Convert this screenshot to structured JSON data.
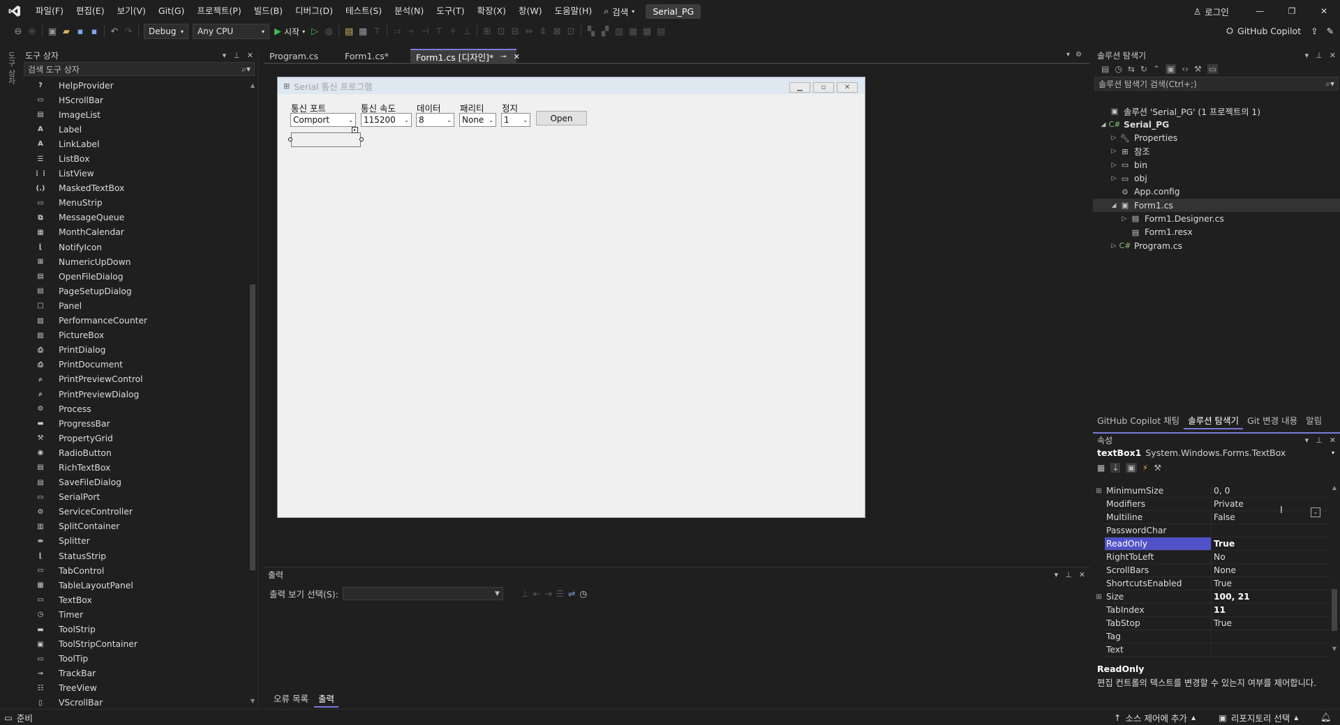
{
  "menu": {
    "items": [
      "파일(F)",
      "편집(E)",
      "보기(V)",
      "Git(G)",
      "프로젝트(P)",
      "빌드(B)",
      "디버그(D)",
      "테스트(S)",
      "분석(N)",
      "도구(T)",
      "확장(X)",
      "창(W)",
      "도움말(H)"
    ],
    "search_label": "검색",
    "solution_badge": "Serial_PG",
    "login_label": "로그인"
  },
  "toolbar": {
    "config": "Debug",
    "platform": "Any CPU",
    "start_label": "시작",
    "copilot_label": "GitHub Copilot"
  },
  "left_strip": {
    "label": "도구 상자"
  },
  "toolbox": {
    "title": "도구 상자",
    "search_placeholder": "검색 도구 상자",
    "items": [
      {
        "label": "HelpProvider",
        "icon": "help-icon"
      },
      {
        "label": "HScrollBar",
        "icon": "hscrollbar-icon"
      },
      {
        "label": "ImageList",
        "icon": "imagelist-icon"
      },
      {
        "label": "Label",
        "icon": "label-icon"
      },
      {
        "label": "LinkLabel",
        "icon": "linklabel-icon"
      },
      {
        "label": "ListBox",
        "icon": "listbox-icon"
      },
      {
        "label": "ListView",
        "icon": "listview-icon"
      },
      {
        "label": "MaskedTextBox",
        "icon": "maskedtextbox-icon"
      },
      {
        "label": "MenuStrip",
        "icon": "menustrip-icon"
      },
      {
        "label": "MessageQueue",
        "icon": "messagequeue-icon"
      },
      {
        "label": "MonthCalendar",
        "icon": "monthcalendar-icon"
      },
      {
        "label": "NotifyIcon",
        "icon": "notifyicon-icon"
      },
      {
        "label": "NumericUpDown",
        "icon": "numericupdown-icon"
      },
      {
        "label": "OpenFileDialog",
        "icon": "openfiledialog-icon"
      },
      {
        "label": "PageSetupDialog",
        "icon": "pagesetupdialog-icon"
      },
      {
        "label": "Panel",
        "icon": "panel-icon"
      },
      {
        "label": "PerformanceCounter",
        "icon": "performancecounter-icon"
      },
      {
        "label": "PictureBox",
        "icon": "picturebox-icon"
      },
      {
        "label": "PrintDialog",
        "icon": "printdialog-icon"
      },
      {
        "label": "PrintDocument",
        "icon": "printdocument-icon"
      },
      {
        "label": "PrintPreviewControl",
        "icon": "printpreviewcontrol-icon"
      },
      {
        "label": "PrintPreviewDialog",
        "icon": "printpreviewdialog-icon"
      },
      {
        "label": "Process",
        "icon": "process-icon"
      },
      {
        "label": "ProgressBar",
        "icon": "progressbar-icon"
      },
      {
        "label": "PropertyGrid",
        "icon": "propertygrid-icon"
      },
      {
        "label": "RadioButton",
        "icon": "radiobutton-icon"
      },
      {
        "label": "RichTextBox",
        "icon": "richtextbox-icon"
      },
      {
        "label": "SaveFileDialog",
        "icon": "savefiledialog-icon"
      },
      {
        "label": "SerialPort",
        "icon": "serialport-icon"
      },
      {
        "label": "ServiceController",
        "icon": "servicecontroller-icon"
      },
      {
        "label": "SplitContainer",
        "icon": "splitcontainer-icon"
      },
      {
        "label": "Splitter",
        "icon": "splitter-icon"
      },
      {
        "label": "StatusStrip",
        "icon": "statusstrip-icon"
      },
      {
        "label": "TabControl",
        "icon": "tabcontrol-icon"
      },
      {
        "label": "TableLayoutPanel",
        "icon": "tablelayoutpanel-icon"
      },
      {
        "label": "TextBox",
        "icon": "textbox-icon"
      },
      {
        "label": "Timer",
        "icon": "timer-icon"
      },
      {
        "label": "ToolStrip",
        "icon": "toolstrip-icon"
      },
      {
        "label": "ToolStripContainer",
        "icon": "toolstripcontainer-icon"
      },
      {
        "label": "ToolTip",
        "icon": "tooltip-icon"
      },
      {
        "label": "TrackBar",
        "icon": "trackbar-icon"
      },
      {
        "label": "TreeView",
        "icon": "treeview-icon"
      },
      {
        "label": "VScrollBar",
        "icon": "vscrollbar-icon"
      }
    ]
  },
  "doc_tabs": [
    {
      "label": "Program.cs",
      "active": false
    },
    {
      "label": "Form1.cs*",
      "active": false
    },
    {
      "label": "Form1.cs [디자인]*",
      "active": true
    }
  ],
  "form": {
    "title": "Serial 통신 프로그램",
    "labels": {
      "port": "통신 포트",
      "speed": "통신 속도",
      "data": "데이터",
      "parity": "패리티",
      "stop": "정지"
    },
    "combos": {
      "port": "Comport",
      "speed": "115200",
      "data": "8",
      "parity": "None",
      "stop": "1"
    },
    "open_button": "Open"
  },
  "output": {
    "title": "출력",
    "select_label": "출력 보기 선택(S):",
    "bottom_tabs": [
      {
        "label": "오류 목록",
        "active": false
      },
      {
        "label": "출력",
        "active": true
      }
    ]
  },
  "solution": {
    "title": "솔루션 탐색기",
    "search_placeholder": "솔루션 탐색기 검색(Ctrl+;)",
    "tree": [
      {
        "label": "솔루션 'Serial_PG' (1 프로젝트의 1)",
        "level": 0,
        "arrow": "",
        "icon": "solution-icon",
        "sel": false,
        "bold": false
      },
      {
        "label": "Serial_PG",
        "level": 0,
        "arrow": "◢",
        "icon": "csproj-icon",
        "sel": false,
        "bold": true
      },
      {
        "label": "Properties",
        "level": 1,
        "arrow": "▷",
        "icon": "wrench-icon",
        "sel": false,
        "bold": false
      },
      {
        "label": "참조",
        "level": 1,
        "arrow": "▷",
        "icon": "references-icon",
        "sel": false,
        "bold": false
      },
      {
        "label": "bin",
        "level": 1,
        "arrow": "▷",
        "icon": "folder-icon",
        "sel": false,
        "bold": false
      },
      {
        "label": "obj",
        "level": 1,
        "arrow": "▷",
        "icon": "folder-icon",
        "sel": false,
        "bold": false
      },
      {
        "label": "App.config",
        "level": 1,
        "arrow": "",
        "icon": "config-icon",
        "sel": false,
        "bold": false
      },
      {
        "label": "Form1.cs",
        "level": 1,
        "arrow": "◢",
        "icon": "form-icon",
        "sel": true,
        "bold": false
      },
      {
        "label": "Form1.Designer.cs",
        "level": 2,
        "arrow": "▷",
        "icon": "cs-file-icon",
        "sel": false,
        "bold": false
      },
      {
        "label": "Form1.resx",
        "level": 2,
        "arrow": "",
        "icon": "resx-icon",
        "sel": false,
        "bold": false
      },
      {
        "label": "Program.cs",
        "level": 1,
        "arrow": "▷",
        "icon": "csharp-icon",
        "sel": false,
        "bold": false
      }
    ],
    "bottom_tabs": [
      {
        "label": "GitHub Copilot 채팅",
        "active": false
      },
      {
        "label": "솔루션 탐색기",
        "active": true
      },
      {
        "label": "Git 변경 내용",
        "active": false
      },
      {
        "label": "알림",
        "active": false
      }
    ]
  },
  "properties": {
    "title": "속성",
    "object_name": "textBox1",
    "object_type": "System.Windows.Forms.TextBox",
    "rows": [
      {
        "name": "MinimumSize",
        "value": "0, 0",
        "expandable": true,
        "bold": false,
        "sel": false
      },
      {
        "name": "Modifiers",
        "value": "Private",
        "expandable": false,
        "bold": false,
        "sel": false
      },
      {
        "name": "Multiline",
        "value": "False",
        "expandable": false,
        "bold": false,
        "sel": false
      },
      {
        "name": "PasswordChar",
        "value": "",
        "expandable": false,
        "bold": false,
        "sel": false
      },
      {
        "name": "ReadOnly",
        "value": "True",
        "expandable": false,
        "bold": true,
        "sel": true
      },
      {
        "name": "RightToLeft",
        "value": "No",
        "expandable": false,
        "bold": false,
        "sel": false
      },
      {
        "name": "ScrollBars",
        "value": "None",
        "expandable": false,
        "bold": false,
        "sel": false
      },
      {
        "name": "ShortcutsEnabled",
        "value": "True",
        "expandable": false,
        "bold": false,
        "sel": false
      },
      {
        "name": "Size",
        "value": "100, 21",
        "expandable": true,
        "bold": true,
        "sel": false
      },
      {
        "name": "TabIndex",
        "value": "11",
        "expandable": false,
        "bold": true,
        "sel": false
      },
      {
        "name": "TabStop",
        "value": "True",
        "expandable": false,
        "bold": false,
        "sel": false
      },
      {
        "name": "Tag",
        "value": "",
        "expandable": false,
        "bold": false,
        "sel": false
      },
      {
        "name": "Text",
        "value": "",
        "expandable": false,
        "bold": false,
        "sel": false
      }
    ],
    "desc_title": "ReadOnly",
    "desc_text": "편집 컨트롤의 텍스트를 변경할 수 있는지 여부를 제어합니다."
  },
  "status": {
    "ready": "준비",
    "source_control": "소스 제어에 추가",
    "repo_select": "리포지토리 선택"
  },
  "colors": {
    "accent": "#7b7bd8",
    "selected_prop": "#5252c8",
    "background": "#1f1f1f",
    "form_bg": "#f0f0f0"
  }
}
